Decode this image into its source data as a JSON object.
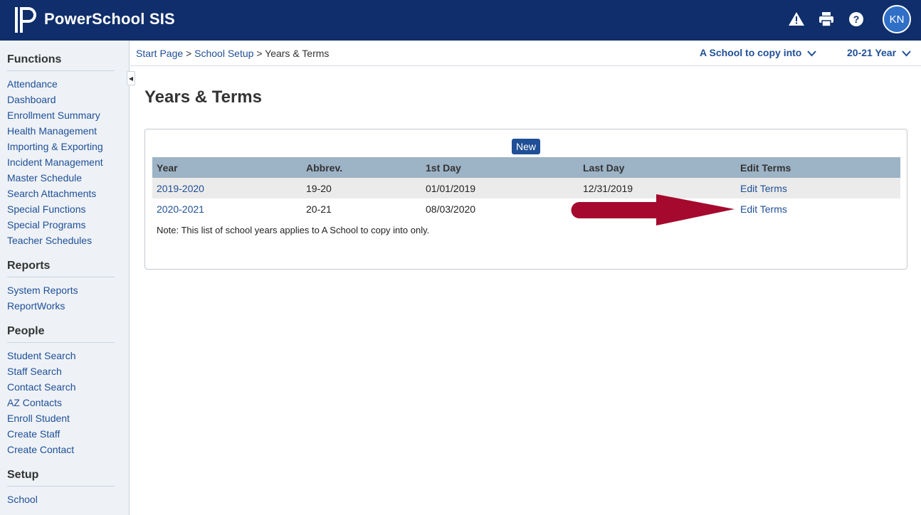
{
  "app": {
    "title": "PowerSchool SIS",
    "user_initials": "KN"
  },
  "header_icons": [
    "alert-icon",
    "print-icon",
    "help-icon"
  ],
  "sidebar": {
    "sections": [
      {
        "heading": "Functions",
        "items": [
          "Attendance",
          "Dashboard",
          "Enrollment Summary",
          "Health Management",
          "Importing & Exporting",
          "Incident Management",
          "Master Schedule",
          "Search Attachments",
          "Special Functions",
          "Special Programs",
          "Teacher Schedules"
        ]
      },
      {
        "heading": "Reports",
        "items": [
          "System Reports",
          "ReportWorks"
        ]
      },
      {
        "heading": "People",
        "items": [
          "Student Search",
          "Staff Search",
          "Contact Search",
          "AZ Contacts",
          "Enroll Student",
          "Create Staff",
          "Create Contact"
        ]
      },
      {
        "heading": "Setup",
        "items": [
          "School"
        ]
      }
    ]
  },
  "breadcrumb": {
    "items": [
      "Start Page",
      "School Setup"
    ],
    "current": "Years & Terms",
    "separator": ">"
  },
  "selectors": {
    "school": "A School to copy into",
    "year": "20-21 Year"
  },
  "page_title": "Years & Terms",
  "panel": {
    "new_label": "New",
    "columns": [
      "Year",
      "Abbrev.",
      "1st Day",
      "Last Day",
      "Edit Terms"
    ],
    "rows": [
      {
        "year": "2019-2020",
        "abbrev": "19-20",
        "first_day": "01/01/2019",
        "last_day": "12/31/2019",
        "edit": "Edit Terms"
      },
      {
        "year": "2020-2021",
        "abbrev": "20-21",
        "first_day": "08/03/2020",
        "last_day": "",
        "edit": "Edit Terms"
      }
    ],
    "note": "Note: This list of school years applies to A School to copy into only."
  },
  "colors": {
    "header_bg": "#0f2e6b",
    "link": "#1f4f96",
    "table_header": "#9db3c6",
    "arrow": "#a50a2e"
  }
}
